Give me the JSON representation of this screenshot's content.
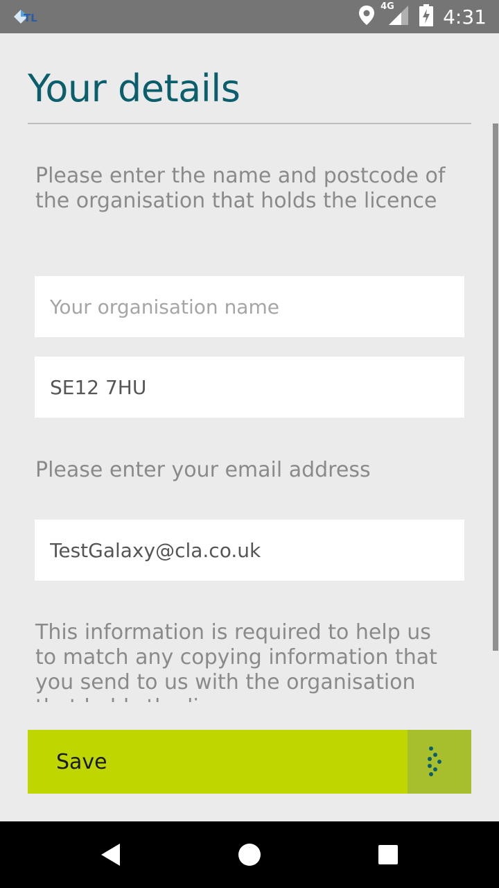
{
  "status_bar": {
    "time": "4:31",
    "network": "4G",
    "icons": [
      "app-notification-icon",
      "location-icon",
      "cellular-signal-icon",
      "battery-charging-icon"
    ]
  },
  "page": {
    "title": "Your details",
    "org_instruction": "Please enter the name and postcode of the organisation that holds the licence",
    "org_name": {
      "placeholder": "Your organisation name",
      "value": ""
    },
    "postcode": {
      "value": "SE12 7HU"
    },
    "email_instruction": "Please enter your email address",
    "email": {
      "value": "TestGalaxy@cla.co.uk"
    },
    "info_text": "This information is required to help us to match any copying information that you send to us with the organisation that holds the licence"
  },
  "save_button": {
    "label": "Save",
    "icon": "dots-arrow-icon"
  },
  "nav_bar": {
    "buttons": [
      "back-icon",
      "home-icon",
      "recents-icon"
    ]
  },
  "colors": {
    "title": "#0b5f6d",
    "accent": "#bfd600",
    "accent_dark": "#a7bf2d",
    "background": "#ebebeb"
  }
}
